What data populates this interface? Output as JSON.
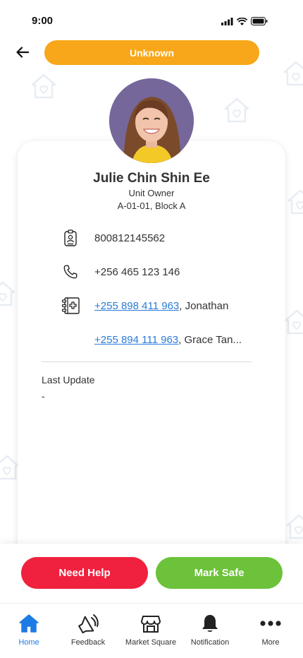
{
  "status_bar": {
    "time": "9:00"
  },
  "header": {
    "status_label": "Unknown"
  },
  "profile": {
    "name": "Julie Chin Shin Ee",
    "role": "Unit Owner",
    "unit": "A-01-01, Block A"
  },
  "details": {
    "id_number": "800812145562",
    "phone": "+256 465 123 146",
    "emergency_contacts": [
      {
        "phone": "+255 898 411 963",
        "name": ", Jonathan"
      },
      {
        "phone": "+255 894 111 963",
        "name": ", Grace Tan..."
      }
    ]
  },
  "last_update": {
    "label": "Last Update",
    "value": "-"
  },
  "actions": {
    "need_help": "Need Help",
    "mark_safe": "Mark Safe"
  },
  "tabs": [
    {
      "label": "Home",
      "icon": "home-icon",
      "active": true
    },
    {
      "label": "Feedback",
      "icon": "megaphone-icon",
      "active": false
    },
    {
      "label": "Market Square",
      "icon": "store-icon",
      "active": false
    },
    {
      "label": "Notification",
      "icon": "bell-icon",
      "active": false
    },
    {
      "label": "More",
      "icon": "more-icon",
      "active": false
    }
  ],
  "colors": {
    "status_pill": "#f7a719",
    "need_help": "#f0213e",
    "mark_safe": "#6cc23a",
    "link": "#2b7bd6",
    "active_tab": "#1e7be3"
  }
}
